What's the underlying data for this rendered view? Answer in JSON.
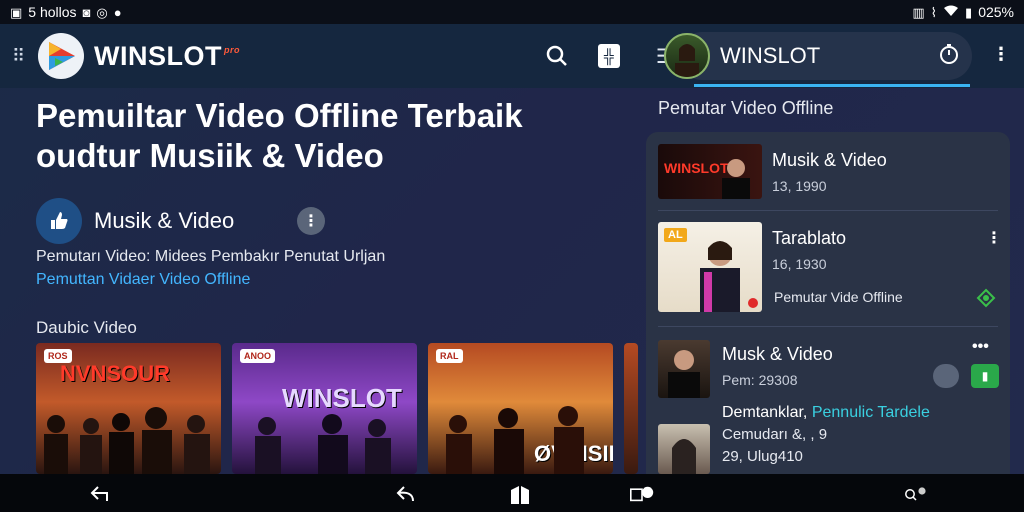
{
  "status_bar": {
    "left_text": "5  hollos",
    "right_text": "025%",
    "icons_left": [
      "notification-icon",
      "media-icon",
      "sync-icon",
      "chrome-icon"
    ],
    "icons_right": [
      "sim-icon",
      "vibrate-icon",
      "wifi-icon",
      "battery-icon"
    ]
  },
  "app_bar": {
    "brand": "WINSLOT",
    "brand_tag": "pro",
    "icons": [
      "grip-icon",
      "logo-icon",
      "search-icon",
      "pin-icon"
    ]
  },
  "main": {
    "headline_line1": "Pemuiltar Video Offline Terbaik",
    "headline_line2": "oudtur Musiik & Video",
    "channel": {
      "name": "Musik & Video",
      "more": "⋮"
    },
    "description": "Pemutarı Video: Midees Pembakır Penutat Urljan",
    "description_link": "Pemuttan Vidaer Video Offline",
    "section_title": "Daubic Video",
    "thumbnails": [
      {
        "label": "NVNSOUR",
        "badge": "ROS"
      },
      {
        "label": "WINSLOT",
        "badge": "ANOO"
      },
      {
        "label": "ØVNISIR",
        "badge": "RAL"
      }
    ]
  },
  "right_panel": {
    "header_title": "WINSLOT",
    "section_title": "Pemutar Video Offline",
    "items": [
      {
        "title": "Musik & Video",
        "subtitle": "13, 1990",
        "thumb_label": "WINSLOT"
      },
      {
        "title": "Tarablato",
        "subtitle": "16, 1930",
        "extra": "Pemutar Vide Offline",
        "thumb_label": "AL"
      },
      {
        "title": "Musk & Video",
        "subtitle": "Pem: 29308"
      },
      {
        "title": "Demtanklar,",
        "title_link": "Pennulic Tardele",
        "line2": "Cemudarı &, , 9",
        "line3": "29, Ulug410"
      }
    ]
  },
  "nav_bar": {
    "icons": [
      "back-icon",
      "back-icon-2",
      "home-icon",
      "recents-icon",
      "search-zoom-icon"
    ]
  },
  "colors": {
    "accent": "#3ab4f2",
    "link": "#43b6ff",
    "green": "#2aa84a",
    "appbar": "#15273f"
  }
}
